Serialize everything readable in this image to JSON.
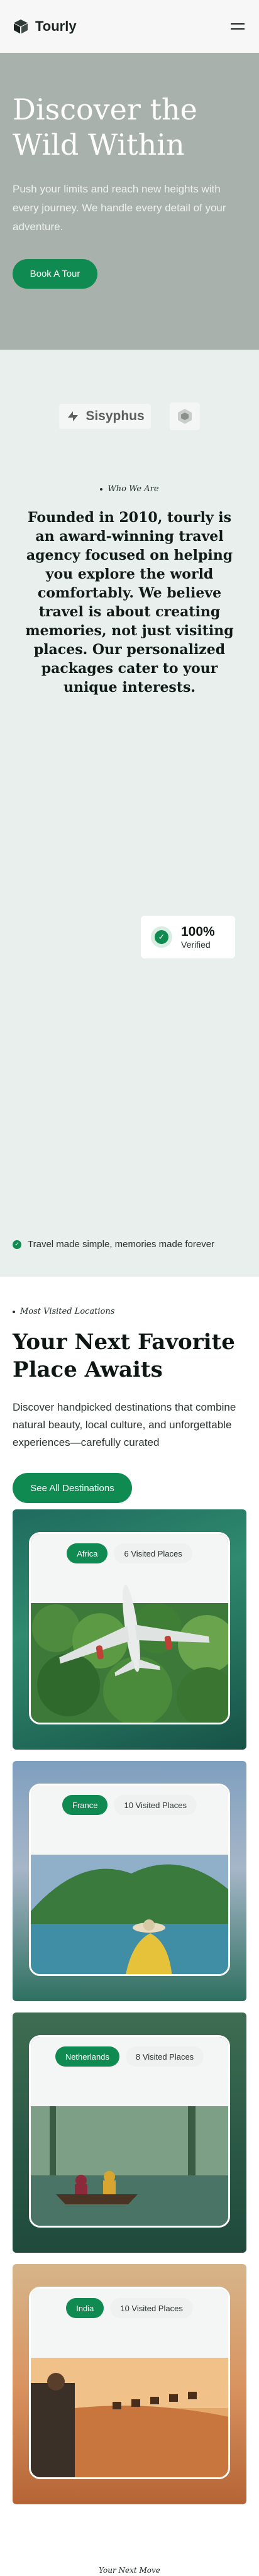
{
  "header": {
    "brand": "Tourly",
    "logo_icon": "cube-logo-icon",
    "menu_icon": "hamburger-menu-icon"
  },
  "hero": {
    "title": "Discover the Wild Within",
    "text": "Push your limits and reach new heights with every journey. We handle every detail of your adventure.",
    "button": "Book A Tour"
  },
  "about": {
    "partners": [
      {
        "name": "Sisyphus",
        "icon": "sisyphus-logo-icon"
      },
      {
        "name": "",
        "icon": "hexagon-logo-icon"
      }
    ],
    "eyebrow": "Who We Are",
    "text": "Founded in 2010, tourly is an award-winning travel agency focused on helping you explore the world comfortably. We believe travel is about creating memories, not just visiting places. Our personalized packages cater to your unique interests.",
    "verified": {
      "value": "100%",
      "label": "Verified",
      "icon": "verified-check-icon"
    },
    "tagline": "Travel made simple, memories made forever"
  },
  "destinations": {
    "eyebrow": "Most Visited Locations",
    "title": "Your Next Favorite Place Awaits",
    "text": "Discover handpicked destinations that combine natural beauty, local culture, and unforgettable experiences—carefully curated",
    "button": "See All Destinations",
    "cards": [
      {
        "country": "Africa",
        "places": "6 Visited Places",
        "image": "airplane-over-forest"
      },
      {
        "country": "France",
        "places": "10 Visited Places",
        "image": "woman-in-hat-island-view"
      },
      {
        "country": "Netherlands",
        "places": "8 Visited Places",
        "image": "canoe-on-misty-river"
      },
      {
        "country": "India",
        "places": "10 Visited Places",
        "image": "desert-camel-caravan"
      }
    ]
  },
  "footer": {
    "eyebrow": "Your Next Move"
  },
  "colors": {
    "accent": "#0f8a50",
    "hero_bg": "#a9b1ad",
    "about_bg": "#e8efec"
  }
}
